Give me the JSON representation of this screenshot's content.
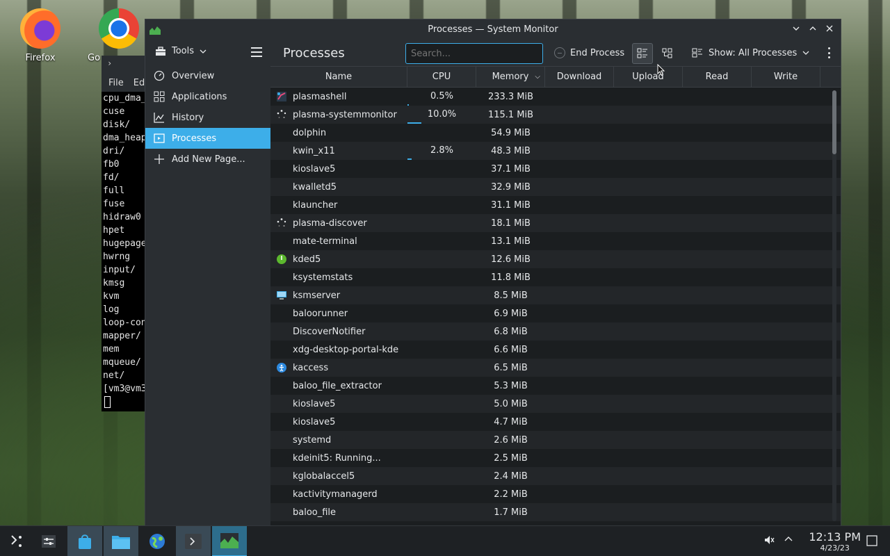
{
  "desktop": {
    "icons": [
      {
        "label": "Firefox"
      },
      {
        "label": "Go"
      }
    ]
  },
  "terminal": {
    "menu": [
      "File",
      "Ed"
    ],
    "lines": [
      "cpu_dma_",
      "cuse",
      "disk/",
      "dma_heap",
      "dri/",
      "fb0",
      "fd/",
      "full",
      "fuse",
      "hidraw0",
      "hpet",
      "hugepage",
      "hwrng",
      "input/",
      "kmsg",
      "kvm",
      "log",
      "loop-con",
      "mapper/",
      "mem",
      "mqueue/",
      "net/",
      "[vm3@vm3"
    ]
  },
  "window": {
    "title": "Processes — System Monitor"
  },
  "sidebar": {
    "tools_label": "Tools",
    "items": [
      {
        "label": "Overview",
        "icon": "gauge-icon"
      },
      {
        "label": "Applications",
        "icon": "apps-grid-icon"
      },
      {
        "label": "History",
        "icon": "chart-icon"
      },
      {
        "label": "Processes",
        "icon": "process-icon",
        "active": true
      },
      {
        "label": "Add New Page...",
        "icon": "plus-icon"
      }
    ]
  },
  "toolbar": {
    "page_title": "Processes",
    "search_placeholder": "Search...",
    "end_process_label": "End Process",
    "show_label": "Show: All Processes"
  },
  "table": {
    "columns": [
      "Name",
      "CPU",
      "Memory",
      "Download",
      "Upload",
      "Read",
      "Write"
    ],
    "rows": [
      {
        "name": "plasmashell",
        "cpu": "0.5%",
        "cpu_level": 0.5,
        "mem": "233.3 MiB",
        "icon": "plasma"
      },
      {
        "name": "plasma-systemmonitor",
        "cpu": "10.0%",
        "cpu_level": 10.0,
        "mem": "115.1 MiB",
        "icon": "spinner"
      },
      {
        "name": "dolphin",
        "cpu": "",
        "cpu_level": 0,
        "mem": "54.9 MiB",
        "icon": ""
      },
      {
        "name": "kwin_x11",
        "cpu": "2.8%",
        "cpu_level": 2.8,
        "mem": "48.3 MiB",
        "icon": ""
      },
      {
        "name": "kioslave5",
        "cpu": "",
        "cpu_level": 0,
        "mem": "37.1 MiB",
        "icon": ""
      },
      {
        "name": "kwalletd5",
        "cpu": "",
        "cpu_level": 0,
        "mem": "32.9 MiB",
        "icon": ""
      },
      {
        "name": "klauncher",
        "cpu": "",
        "cpu_level": 0,
        "mem": "31.1 MiB",
        "icon": ""
      },
      {
        "name": "plasma-discover",
        "cpu": "",
        "cpu_level": 0,
        "mem": "18.1 MiB",
        "icon": "spinner"
      },
      {
        "name": "mate-terminal",
        "cpu": "",
        "cpu_level": 0,
        "mem": "13.1 MiB",
        "icon": ""
      },
      {
        "name": "kded5",
        "cpu": "",
        "cpu_level": 0,
        "mem": "12.6 MiB",
        "icon": "green"
      },
      {
        "name": "ksystemstats",
        "cpu": "",
        "cpu_level": 0,
        "mem": "11.8 MiB",
        "icon": ""
      },
      {
        "name": "ksmserver",
        "cpu": "",
        "cpu_level": 0,
        "mem": "8.5 MiB",
        "icon": "monitor"
      },
      {
        "name": "baloorunner",
        "cpu": "",
        "cpu_level": 0,
        "mem": "6.9 MiB",
        "icon": ""
      },
      {
        "name": "DiscoverNotifier",
        "cpu": "",
        "cpu_level": 0,
        "mem": "6.8 MiB",
        "icon": ""
      },
      {
        "name": "xdg-desktop-portal-kde",
        "cpu": "",
        "cpu_level": 0,
        "mem": "6.6 MiB",
        "icon": ""
      },
      {
        "name": "kaccess",
        "cpu": "",
        "cpu_level": 0,
        "mem": "6.5 MiB",
        "icon": "blue"
      },
      {
        "name": "baloo_file_extractor",
        "cpu": "",
        "cpu_level": 0,
        "mem": "5.3 MiB",
        "icon": ""
      },
      {
        "name": "kioslave5",
        "cpu": "",
        "cpu_level": 0,
        "mem": "5.0 MiB",
        "icon": ""
      },
      {
        "name": "kioslave5",
        "cpu": "",
        "cpu_level": 0,
        "mem": "4.7 MiB",
        "icon": ""
      },
      {
        "name": "systemd",
        "cpu": "",
        "cpu_level": 0,
        "mem": "2.6 MiB",
        "icon": ""
      },
      {
        "name": "kdeinit5: Running...",
        "cpu": "",
        "cpu_level": 0,
        "mem": "2.5 MiB",
        "icon": ""
      },
      {
        "name": "kglobalaccel5",
        "cpu": "",
        "cpu_level": 0,
        "mem": "2.4 MiB",
        "icon": ""
      },
      {
        "name": "kactivitymanagerd",
        "cpu": "",
        "cpu_level": 0,
        "mem": "2.2 MiB",
        "icon": ""
      },
      {
        "name": "baloo_file",
        "cpu": "",
        "cpu_level": 0,
        "mem": "1.7 MiB",
        "icon": ""
      }
    ]
  },
  "taskbar": {
    "time": "12:13 PM",
    "date": "4/23/23"
  },
  "colors": {
    "accent": "#3daee9",
    "window_bg": "#1b1e20",
    "panel_bg": "#2a2e32"
  }
}
